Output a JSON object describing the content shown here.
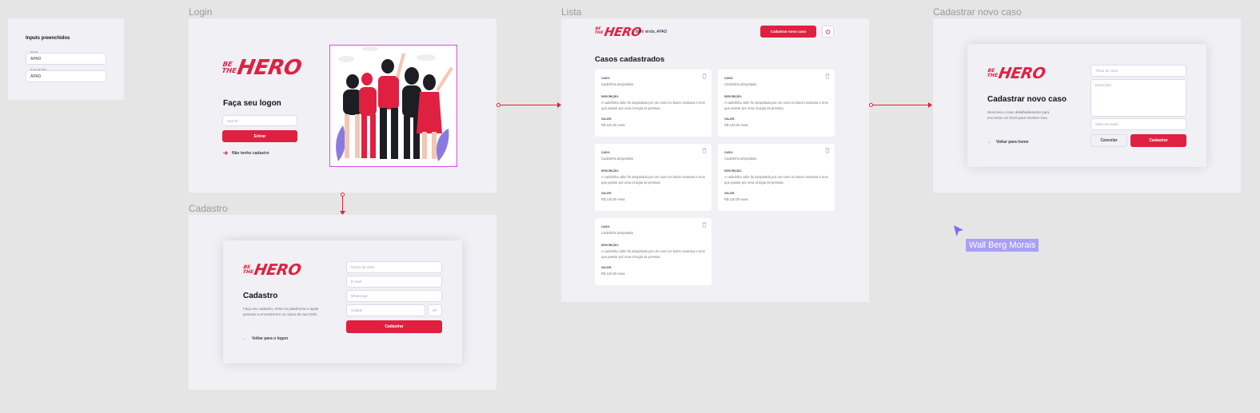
{
  "colors": {
    "accent": "#e02041",
    "canvas": "#e5e5e5",
    "frame": "#f0f0f5",
    "cursor": "#7c6cf0"
  },
  "inputs_panel": {
    "title": "Inputs preenchidos",
    "fields": [
      {
        "label": "Sua ID",
        "value": "APAD"
      },
      {
        "label": "Nome da ONG",
        "value": "APAD"
      }
    ]
  },
  "frames": {
    "login": "Login",
    "cadastro": "Cadastro",
    "lista": "Lista",
    "novo_caso": "Cadastrar novo caso"
  },
  "logo": {
    "be": "BE",
    "the": "THE",
    "hero": "HERO"
  },
  "login": {
    "title": "Faça seu logon",
    "id_placeholder": "Sua ID",
    "submit": "Entrar",
    "register_link": "Não tenho cadastro"
  },
  "cadastro": {
    "title": "Cadastro",
    "description": "Faça seu cadastro, entre na plataforma e ajude pessoas a encontrarem os casos da sua ONG.",
    "back_link": "Voltar para o logon",
    "placeholders": {
      "name": "Nome da ONG",
      "email": "E-mail",
      "whatsapp": "WhatsApp",
      "city": "Cidade",
      "uf": "UF"
    },
    "submit": "Cadastrar"
  },
  "lista": {
    "welcome": "Bem vinda, APAD",
    "new_case_button": "Cadastrar novo caso",
    "title": "Casos cadastrados",
    "labels": {
      "case": "CASO:",
      "description": "DESCRIÇÃO:",
      "value": "VALOR:"
    },
    "cases": [
      {
        "case": "Cadelinha atropelada",
        "description": "A cadelinha Jolie foi atropelada por um carro no bairro Santana e teve que passar por uma cirurgia às pressas.",
        "value": "R$ 120,00 reais"
      },
      {
        "case": "Cadelinha atropelada",
        "description": "A cadelinha Jolie foi atropelada por um carro no bairro Santana e teve que passar por uma cirurgia às pressas.",
        "value": "R$ 120,00 reais"
      },
      {
        "case": "Cadelinha atropelada",
        "description": "A cadelinha Jolie foi atropelada por um carro no bairro Santana e teve que passar por uma cirurgia às pressas.",
        "value": "R$ 120,00 reais"
      },
      {
        "case": "Cadelinha atropelada",
        "description": "A cadelinha Jolie foi atropelada por um carro no bairro Santana e teve que passar por uma cirurgia às pressas.",
        "value": "R$ 120,00 reais"
      },
      {
        "case": "Cadelinha atropelada",
        "description": "A cadelinha Jolie foi atropelada por um carro no bairro Santana e teve que passar por uma cirurgia às pressas.",
        "value": "R$ 120,00 reais"
      }
    ]
  },
  "novo_caso": {
    "title": "Cadastrar novo caso",
    "description": "Descreva o caso detalhadamente para encontrar um herói para resolver isso.",
    "back_link": "Voltar para home",
    "placeholders": {
      "title": "Título do caso",
      "description": "Descrição",
      "value": "Valor em reais"
    },
    "cancel": "Cancelar",
    "submit": "Cadastrar"
  },
  "collaborator": {
    "name": "Wall Berg Morais"
  }
}
